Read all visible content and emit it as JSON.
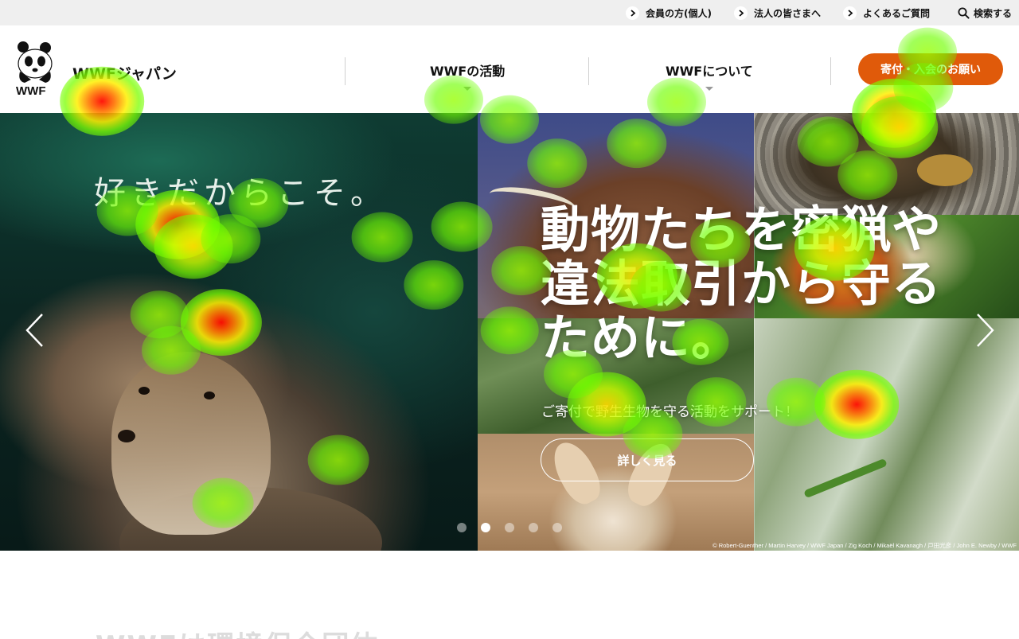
{
  "utility_bar": {
    "links": [
      {
        "label": "会員の方(個人)"
      },
      {
        "label": "法人の皆さまへ"
      },
      {
        "label": "よくあるご質問"
      }
    ],
    "search_label": "検索する"
  },
  "header": {
    "logo_text": "WWF",
    "site_name": "WWFジャパン",
    "nav": [
      {
        "label": "WWFの活動"
      },
      {
        "label": "WWFについて"
      }
    ],
    "donate_label": "寄付・入会のお願い"
  },
  "hero": {
    "tagline": "好きだからこそ。",
    "heading_line1": "動物たちを密猟や",
    "heading_line2": "違法取引から守る",
    "heading_line3": "ために。",
    "subtext": "ご寄付で野生生物を守る活動をサポート！",
    "cta_label": "詳しく見る",
    "slides_total": 5,
    "active_slide": 2,
    "photo_credit": "© Robert-Guenther / Martin Harvey / WWF Japan / Zig Koch / Mikaël Kavanagh / 戸田光彦 / John E. Newby / WWF"
  },
  "below_fold": {
    "section_heading": "WWFは環境保全団体"
  },
  "colors": {
    "accent_orange": "#e05a0a",
    "utility_bg": "#efefef"
  },
  "icons": [
    "chevron-right-icon",
    "search-icon",
    "panda-logo",
    "caret-down-icon",
    "prev-arrow-icon",
    "next-arrow-icon"
  ]
}
